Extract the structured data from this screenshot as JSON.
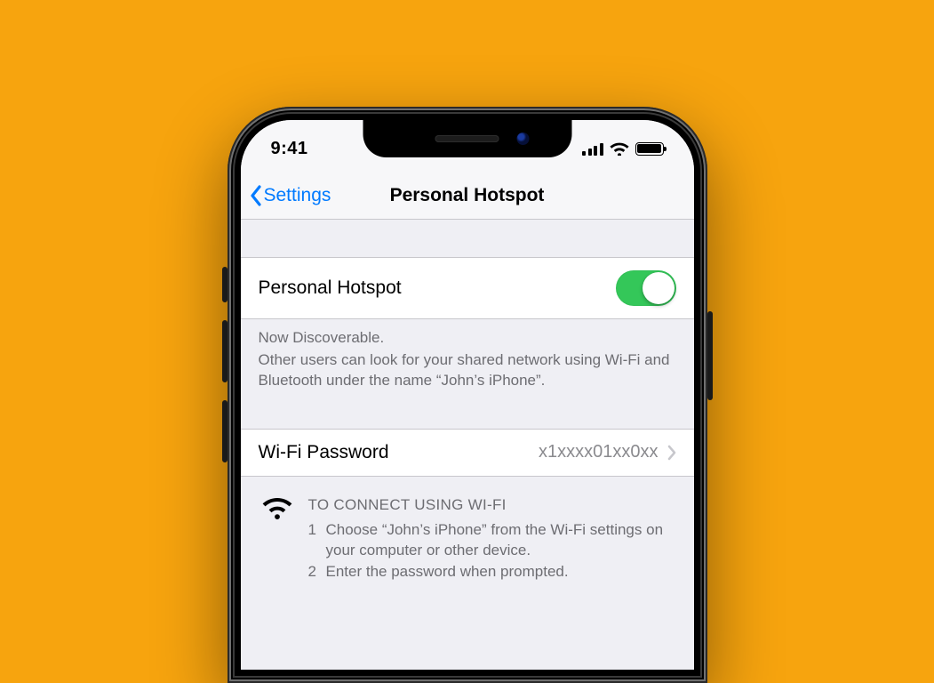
{
  "statusbar": {
    "time": "9:41"
  },
  "nav": {
    "back_label": "Settings",
    "title": "Personal Hotspot"
  },
  "hotspot": {
    "toggle_label": "Personal Hotspot",
    "toggle_on": true,
    "discoverable_title": "Now Discoverable.",
    "discoverable_body": "Other users can look for your shared network using Wi-Fi and Bluetooth under the name “John’s iPhone”."
  },
  "wifi_password": {
    "label": "Wi-Fi Password",
    "value": "x1xxxx01xx0xx"
  },
  "instructions": {
    "heading": "TO CONNECT USING WI-FI",
    "step1_num": "1",
    "step1": "Choose “John’s iPhone” from the Wi-Fi settings on your computer or other device.",
    "step2_num": "2",
    "step2": "Enter the password when prompted."
  }
}
